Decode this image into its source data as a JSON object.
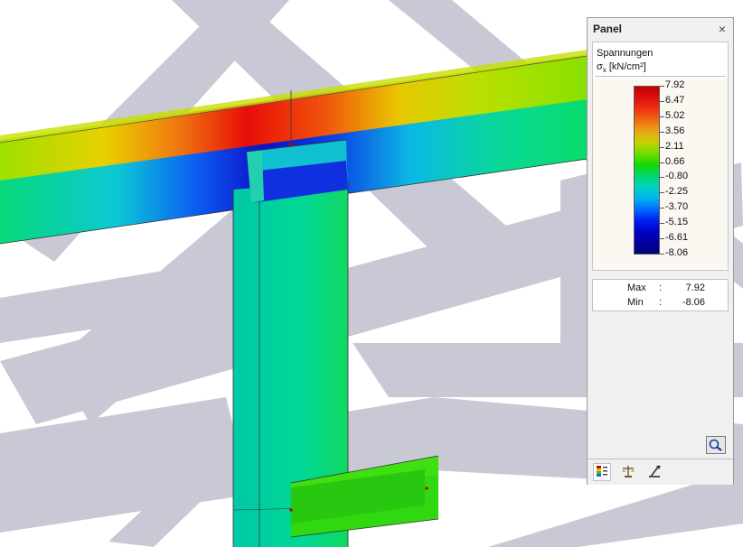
{
  "panel": {
    "title": "Panel",
    "close_glyph": "×",
    "result_name": "Spannungen",
    "quantity": "σ",
    "quantity_sub": "x",
    "unit": "[kN/cm²]",
    "legend_values": [
      "7.92",
      "6.47",
      "5.02",
      "3.56",
      "2.11",
      "0.66",
      "-0.80",
      "-2.25",
      "-3.70",
      "-5.15",
      "-6.61",
      "-8.06"
    ],
    "max_label": "Max",
    "max_value": "7.92",
    "min_label": "Min",
    "min_value": "-8.06",
    "tabs": [
      {
        "icon": "color-scale-icon",
        "active": true
      },
      {
        "icon": "balance-icon",
        "active": false
      },
      {
        "icon": "filter-icon",
        "active": false
      }
    ],
    "zoom_icon": "magnifier-icon"
  },
  "colors": {
    "background": "#ffffff",
    "grey_members": "#c9c9d6",
    "scale_max": "#c00000",
    "scale_min": "#00007a"
  }
}
